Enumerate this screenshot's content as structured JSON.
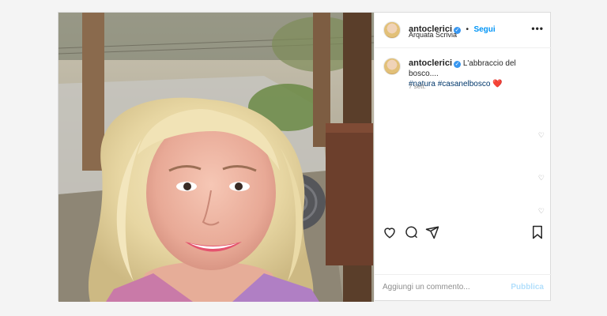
{
  "header": {
    "username": "antoclerici",
    "dot": "•",
    "follow_label": "Segui",
    "location": "Arquata Scrivia",
    "more_label": "•••"
  },
  "caption": {
    "username": "antoclerici",
    "text": "L'abbraccio del bosco....",
    "hashtags": [
      "#natura",
      "#casanelbosco"
    ],
    "emoji": "❤️"
  },
  "date_label": "7 sett.",
  "comment": {
    "placeholder": "Aggiungi un commento...",
    "publish_label": "Pubblica"
  },
  "icons": {
    "verified": "verified-badge-icon",
    "like": "heart-icon",
    "comment": "comment-icon",
    "share": "send-icon",
    "save": "bookmark-icon"
  },
  "colors": {
    "accent_blue": "#0095f6",
    "verified_blue": "#3897f0",
    "hashtag": "#00376b",
    "publish_disabled": "#b2dffc"
  }
}
